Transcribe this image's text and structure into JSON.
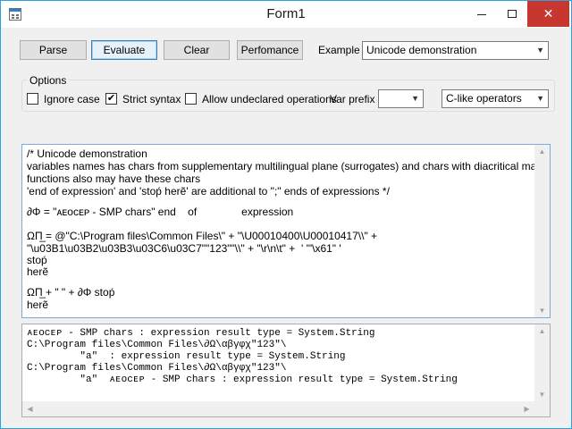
{
  "window": {
    "title": "Form1",
    "minimize_glyph": "",
    "maximize_glyph": "",
    "close_glyph": "✕"
  },
  "toolbar": {
    "parse_label": "Parse",
    "evaluate_label": "Evaluate",
    "clear_label": "Clear",
    "performance_label": "Perfomance",
    "example_label": "Example",
    "example_value": "Unicode demonstration"
  },
  "options": {
    "legend": "Options",
    "ignore_case_label": "Ignore case",
    "ignore_case_checked": false,
    "strict_syntax_label": "Strict syntax",
    "strict_syntax_checked": true,
    "allow_undeclared_label": "Allow undeclared operations",
    "allow_undeclared_checked": false,
    "var_prefix_label": "Var prefix",
    "var_prefix_value": "",
    "operators_value": "C-like operators"
  },
  "input": {
    "lines": [
      "/* Unicode demonstration",
      "variables names has chars from supplementary multilingual plane (surrogates) and chars with diacritical marks",
      "functions also may have these chars",
      "'end of expression' and 'stoṕ herẽ' are additional to \";\" ends of expressions */",
      "",
      "∂Φ = \"ᴀᴇᴏᴄᴇᴘ - SMP chars\" end    of               expression",
      "",
      "ΩΠ̲ = @\"C:\\Program files\\Common Files\\\" + \"\\U00010400\\U00010417\\\\\" +",
      "\"\\u03B1\\u03B2\\u03B3\\u03C6\\u03C7\"\"123\"\"\\\\\" + \"\\r\\n\\t\" +  ' '\"\\x61\" '",
      "stoṕ",
      "herẽ",
      "",
      "ΩΠ̲ + \" \" + ∂Φ stoṕ",
      "herẽ"
    ]
  },
  "output": {
    "lines": [
      "ᴀᴇᴏᴄᴇᴘ - SMP chars : expression result type = System.String",
      "C:\\Program files\\Common Files\\∂Ω\\αβγφχ\"123\"\\",
      "         \"a\"  : expression result type = System.String",
      "C:\\Program files\\Common Files\\∂Ω\\αβγφχ\"123\"\\",
      "         \"a\"  ᴀᴇᴏᴄᴇᴘ - SMP chars : expression result type = System.String"
    ]
  }
}
